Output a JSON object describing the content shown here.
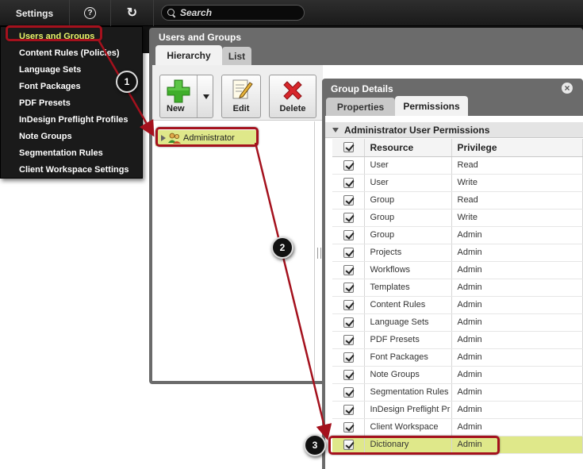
{
  "topbar": {
    "settings_label": "Settings",
    "help_glyph": "?",
    "refresh_glyph": "↻",
    "search_placeholder": "Search"
  },
  "settings_menu": {
    "items": [
      {
        "label": "Users and Groups",
        "active": true
      },
      {
        "label": "Content Rules (Policies)"
      },
      {
        "label": "Language Sets"
      },
      {
        "label": "Font Packages"
      },
      {
        "label": "PDF Presets"
      },
      {
        "label": "InDesign Preflight Profiles"
      },
      {
        "label": "Note Groups"
      },
      {
        "label": "Segmentation Rules"
      },
      {
        "label": "Client Workspace Settings"
      }
    ]
  },
  "users_groups": {
    "title": "Users and Groups",
    "tabs": [
      {
        "label": "Hierarchy"
      },
      {
        "label": "List"
      }
    ],
    "toolbar": {
      "new_label": "New",
      "edit_label": "Edit",
      "delete_label": "Delete"
    },
    "tree": [
      {
        "label": "Administrator"
      }
    ]
  },
  "group_details": {
    "title": "Group Details",
    "close_glyph": "×",
    "tabs": [
      {
        "label": "Properties"
      },
      {
        "label": "Permissions"
      }
    ],
    "section_title": "Administrator User Permissions",
    "columns": {
      "resource": "Resource",
      "privilege": "Privilege"
    },
    "rows": [
      {
        "resource": "User",
        "privilege": "Read"
      },
      {
        "resource": "User",
        "privilege": "Write"
      },
      {
        "resource": "Group",
        "privilege": "Read"
      },
      {
        "resource": "Group",
        "privilege": "Write"
      },
      {
        "resource": "Group",
        "privilege": "Admin"
      },
      {
        "resource": "Projects",
        "privilege": "Admin"
      },
      {
        "resource": "Workflows",
        "privilege": "Admin"
      },
      {
        "resource": "Templates",
        "privilege": "Admin"
      },
      {
        "resource": "Content Rules",
        "privilege": "Admin"
      },
      {
        "resource": "Language Sets",
        "privilege": "Admin"
      },
      {
        "resource": "PDF Presets",
        "privilege": "Admin"
      },
      {
        "resource": "Font Packages",
        "privilege": "Admin"
      },
      {
        "resource": "Note Groups",
        "privilege": "Admin"
      },
      {
        "resource": "Segmentation Rules",
        "privilege": "Admin"
      },
      {
        "resource": "InDesign Preflight Pr",
        "privilege": "Admin"
      },
      {
        "resource": "Client Workspace",
        "privilege": "Admin"
      },
      {
        "resource": "Dictionary",
        "privilege": "Admin",
        "highlighted": true
      }
    ]
  },
  "annotations": {
    "step1": "1",
    "step2": "2",
    "step3": "3",
    "color": "#a4111d"
  },
  "colors": {
    "highlight": "#dfe88a",
    "menu_active": "#e8f56a"
  }
}
